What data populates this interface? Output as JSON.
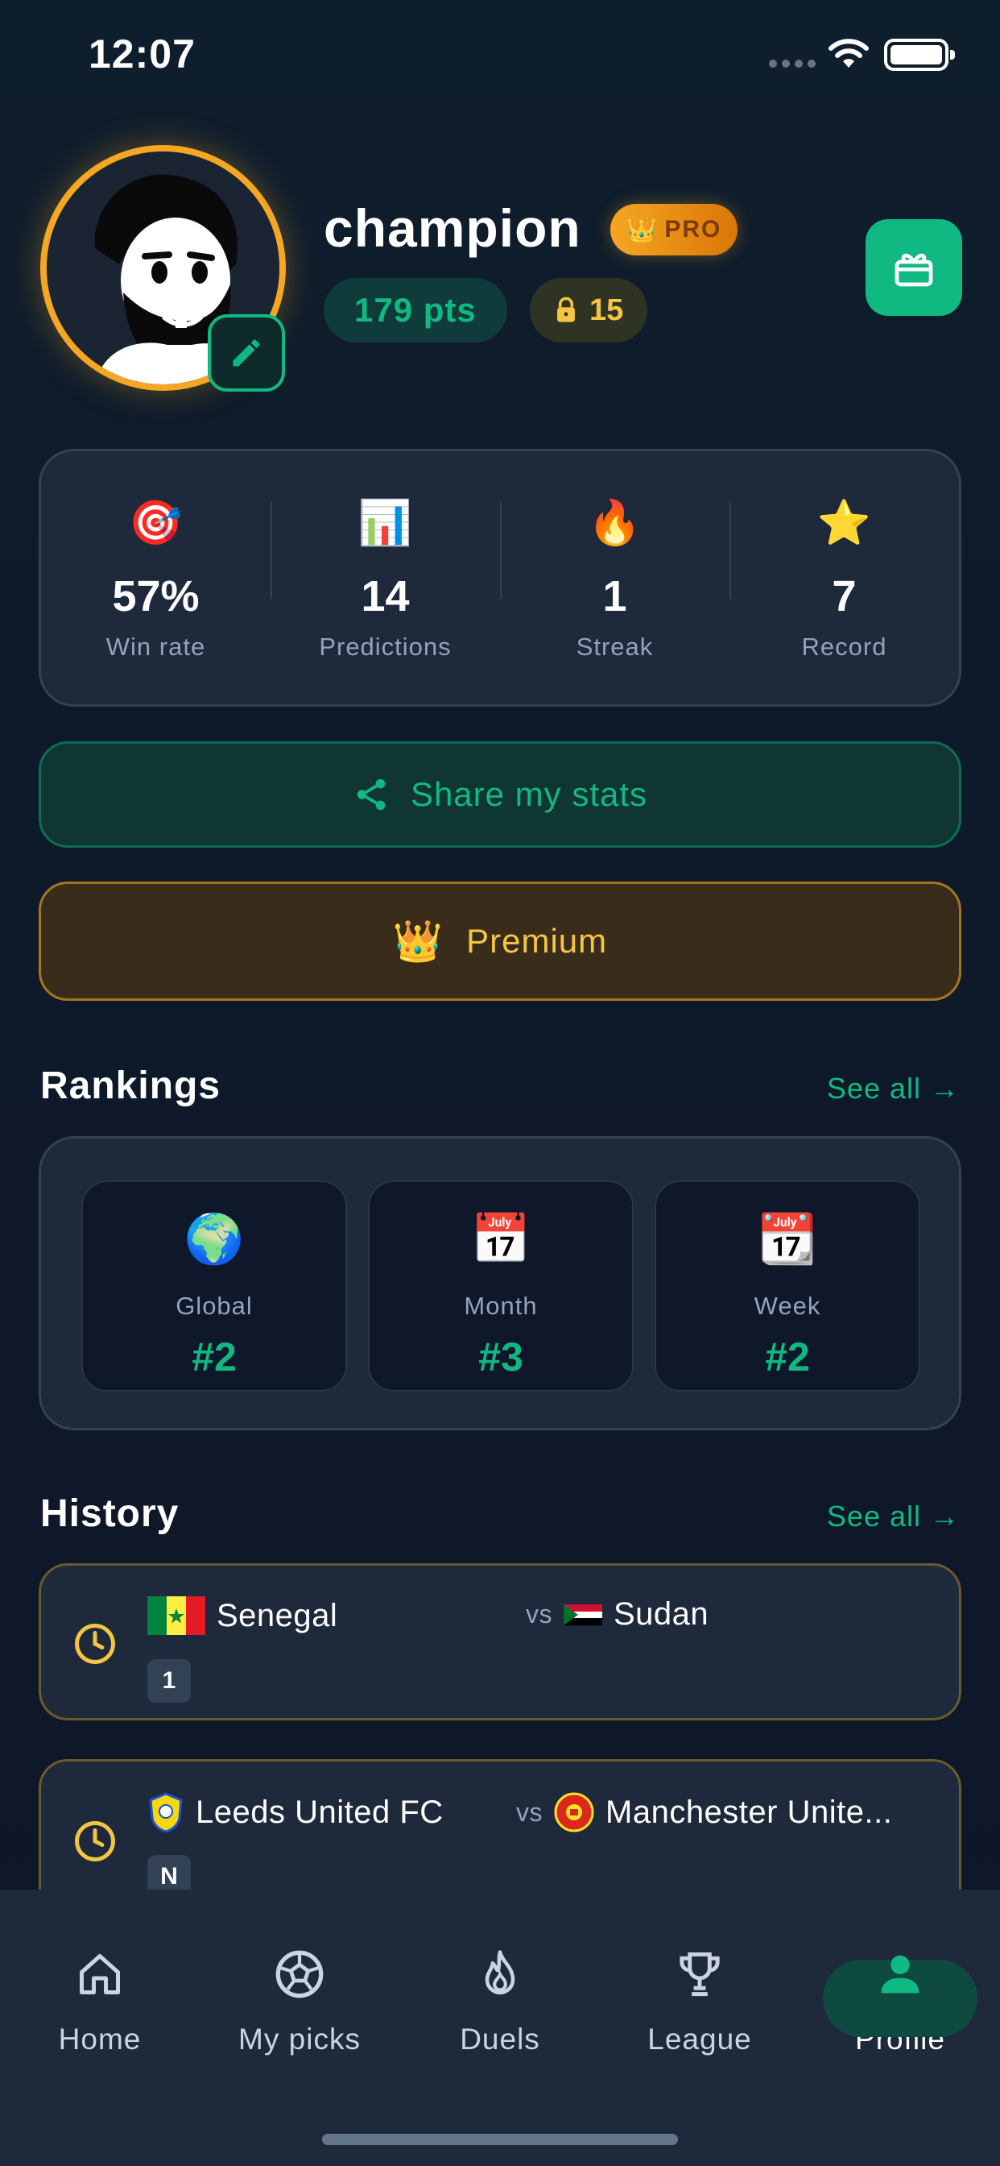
{
  "status_bar": {
    "time": "12:07"
  },
  "profile": {
    "username": "champion",
    "badge": "PRO",
    "points": "179 pts",
    "locked_count": "15"
  },
  "stats": [
    {
      "emoji": "🎯",
      "value": "57%",
      "label": "Win rate"
    },
    {
      "emoji": "📊",
      "value": "14",
      "label": "Predictions"
    },
    {
      "emoji": "🔥",
      "value": "1",
      "label": "Streak"
    },
    {
      "emoji": "⭐",
      "value": "7",
      "label": "Record"
    }
  ],
  "actions": {
    "share_label": "Share my stats",
    "premium_label": "Premium"
  },
  "rankings": {
    "title": "Rankings",
    "see_all": "See all →",
    "items": [
      {
        "emoji": "🌍",
        "label": "Global",
        "value": "#2"
      },
      {
        "emoji": "📅",
        "label": "Month",
        "value": "#3"
      },
      {
        "emoji": "📆",
        "label": "Week",
        "value": "#2"
      }
    ]
  },
  "history": {
    "title": "History",
    "see_all": "See all →",
    "matches": [
      {
        "home": "Senegal",
        "vs": "vs",
        "away": "Sudan",
        "pick": "1"
      },
      {
        "home": "Leeds United FC",
        "vs": "vs",
        "away": "Manchester Unite...",
        "pick": "N"
      }
    ]
  },
  "tabbar": [
    {
      "label": "Home",
      "icon": "home-icon"
    },
    {
      "label": "My picks",
      "icon": "soccer-ball-icon"
    },
    {
      "label": "Duels",
      "icon": "flame-icon"
    },
    {
      "label": "League",
      "icon": "trophy-icon"
    },
    {
      "label": "Profile",
      "icon": "person-icon",
      "active": true
    }
  ],
  "colors": {
    "accent": "#10b981",
    "gold": "#f5a623",
    "card": "#1e293b",
    "background": "#0f172a"
  }
}
